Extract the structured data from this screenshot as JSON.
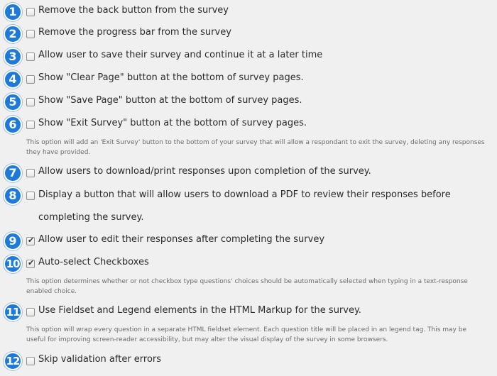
{
  "options": [
    {
      "num": "1",
      "label": "Remove the back button from the survey",
      "checked": false
    },
    {
      "num": "2",
      "label": "Remove the progress bar from the survey",
      "checked": false
    },
    {
      "num": "3",
      "label": "Allow user to save their survey and continue it at a later time",
      "checked": false
    },
    {
      "num": "4",
      "label": "Show \"Clear Page\" button at the bottom of survey pages.",
      "checked": false
    },
    {
      "num": "5",
      "label": "Show \"Save Page\" button at the bottom of survey pages.",
      "checked": false
    },
    {
      "num": "6",
      "label": "Show \"Exit Survey\" button at the bottom of survey pages.",
      "checked": false,
      "description": "This option will add an 'Exit Survey' button to the bottom of your survey that will allow a respondant to exit the survey, deleting any responses they have provided."
    },
    {
      "num": "7",
      "label": "Allow users to download/print responses upon completion of the survey.",
      "checked": false
    },
    {
      "num": "8",
      "label": "Display a button that will allow users to download a PDF to review their responses before completing the survey.",
      "checked": false
    },
    {
      "num": "9",
      "label": "Allow user to edit their responses after completing the survey",
      "checked": true
    },
    {
      "num": "10",
      "label": "Auto-select Checkboxes",
      "checked": true,
      "description": "This option determines whether or not checkbox type questions' choices should be automatically selected when typing in a text-response enabled choice."
    },
    {
      "num": "11",
      "label": "Use Fieldset and Legend elements in the HTML Markup for the survey.",
      "checked": false,
      "description": "This option will wrap every question in a separate HTML fieldset element. Each question title will be placed in an legend tag. This may be useful for improving screen-reader accessibility, but may alter the visual display of the survey in some browsers."
    },
    {
      "num": "12",
      "label": "Skip validation after errors",
      "checked": false
    }
  ],
  "colors": {
    "badge": "#1e7ad8",
    "background": "#f0f0f0"
  }
}
